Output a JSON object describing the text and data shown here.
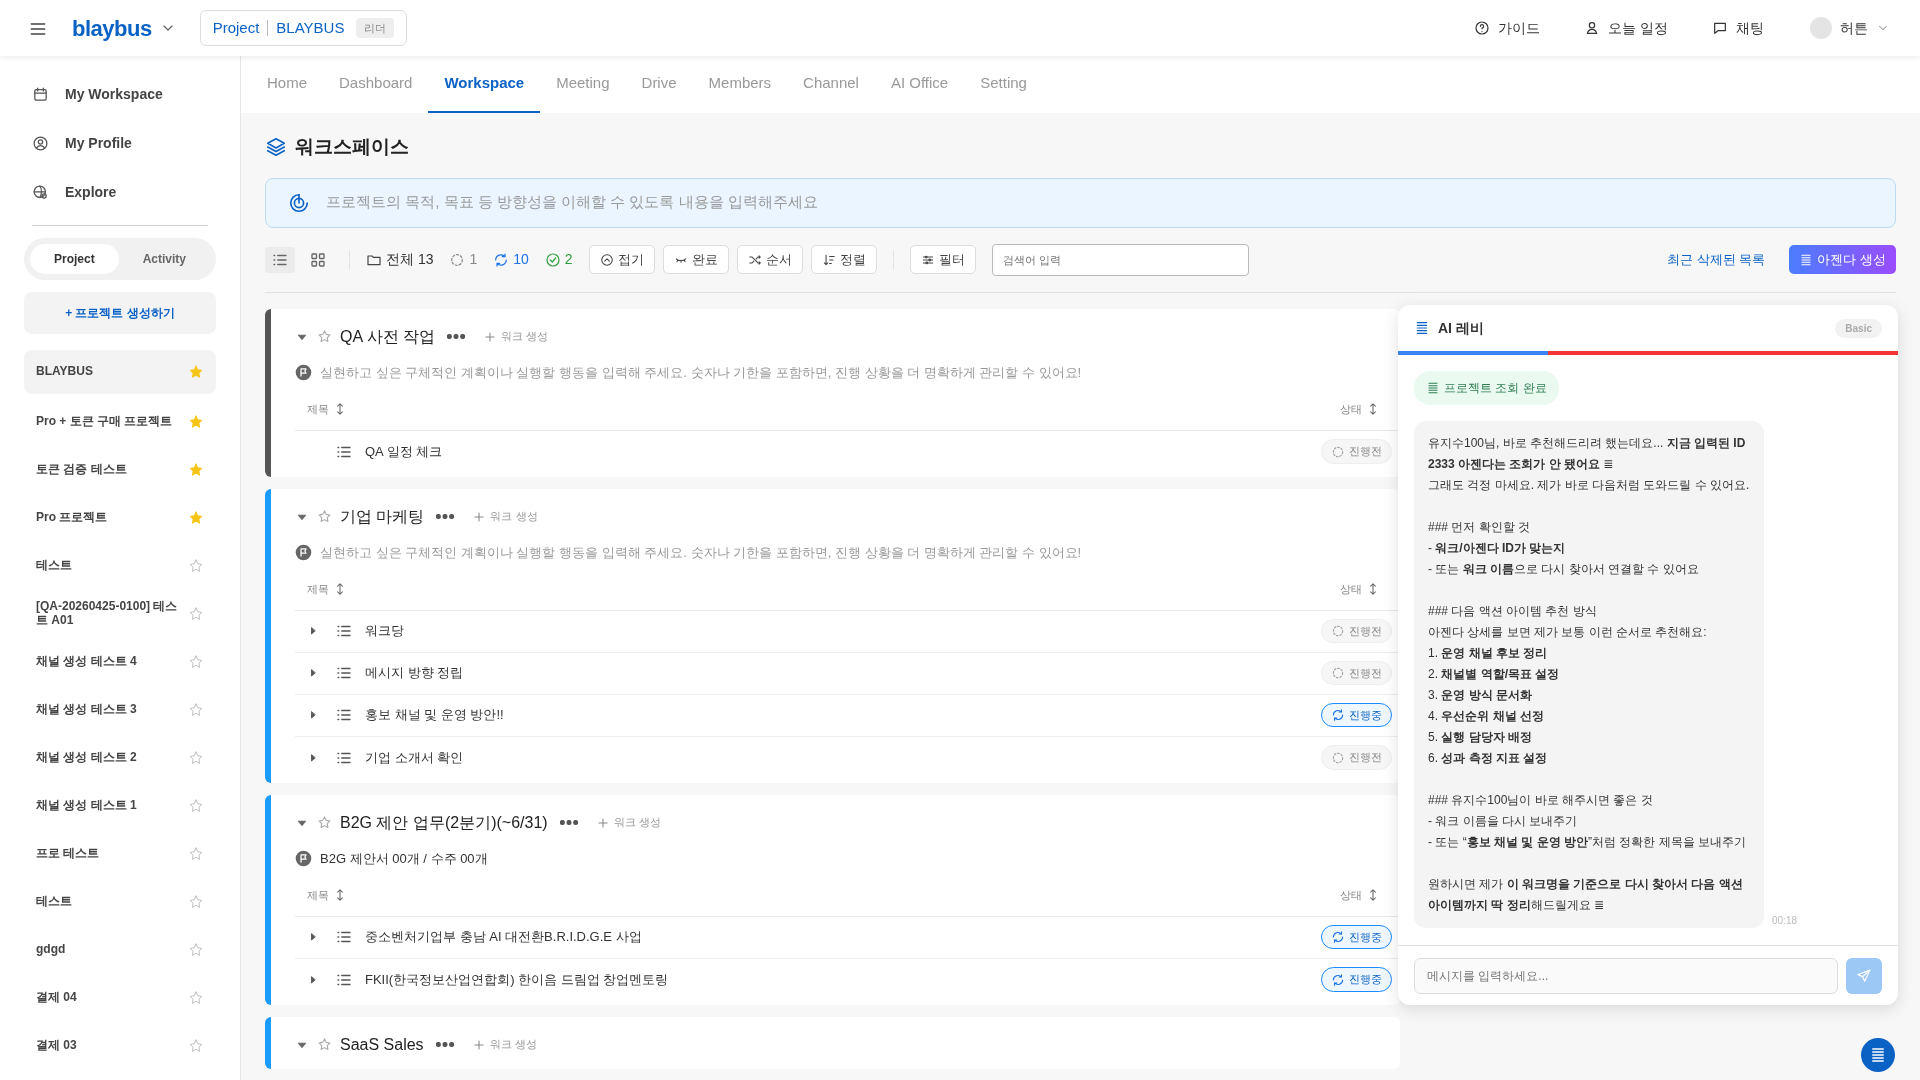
{
  "header": {
    "logo": "blaybus",
    "project_label": "Project",
    "project_name": "BLAYBUS",
    "role": "리더",
    "actions": [
      {
        "kind": "help",
        "label": "가이드"
      },
      {
        "kind": "person",
        "label": "오늘 일정"
      },
      {
        "kind": "chat",
        "label": "채팅"
      }
    ],
    "user": "허튼"
  },
  "sidebar": {
    "nav": [
      {
        "kind": "calendar",
        "label": "My Workspace"
      },
      {
        "kind": "profile",
        "label": "My Profile"
      },
      {
        "kind": "explore",
        "label": "Explore"
      }
    ],
    "segments": [
      {
        "label": "Project",
        "selected": true
      },
      {
        "label": "Activity",
        "selected": false
      }
    ],
    "create_button": "+ 프로젝트 생성하기",
    "projects": [
      {
        "name": "BLAYBUS",
        "selected": true,
        "starred": true
      },
      {
        "name": "Pro + 토큰 구매 프로젝트",
        "selected": false,
        "starred": true
      },
      {
        "name": "토큰 검증 테스트",
        "selected": false,
        "starred": true
      },
      {
        "name": "Pro 프로젝트",
        "selected": false,
        "starred": true
      },
      {
        "name": "테스트",
        "selected": false,
        "starred": false
      },
      {
        "name": "[QA-20260425-0100] 테스트 A01",
        "selected": false,
        "starred": false
      },
      {
        "name": "채널 생성 테스트 4",
        "selected": false,
        "starred": false
      },
      {
        "name": "채널 생성 테스트 3",
        "selected": false,
        "starred": false
      },
      {
        "name": "채널 생성 테스트 2",
        "selected": false,
        "starred": false
      },
      {
        "name": "채널 생성 테스트 1",
        "selected": false,
        "starred": false
      },
      {
        "name": "프로 테스트",
        "selected": false,
        "starred": false
      },
      {
        "name": "테스트",
        "selected": false,
        "starred": false
      },
      {
        "name": "gdgd",
        "selected": false,
        "starred": false
      },
      {
        "name": "결제 04",
        "selected": false,
        "starred": false
      },
      {
        "name": "결제 03",
        "selected": false,
        "starred": false
      }
    ]
  },
  "tabs": [
    {
      "label": "Home",
      "selected": false
    },
    {
      "label": "Dashboard",
      "selected": false
    },
    {
      "label": "Workspace",
      "selected": true
    },
    {
      "label": "Meeting",
      "selected": false
    },
    {
      "label": "Drive",
      "selected": false
    },
    {
      "label": "Members",
      "selected": false
    },
    {
      "label": "Channel",
      "selected": false
    },
    {
      "label": "AI Office",
      "selected": false
    },
    {
      "label": "Setting",
      "selected": false
    }
  ],
  "page_title": "워크스페이스",
  "goal_placeholder": "프로젝트의 목적, 목표 등 방향성을 이해할 수 있도록 내용을 입력해주세요",
  "toolbar": {
    "views": [
      {
        "kind": "list",
        "selected": true
      },
      {
        "kind": "grid",
        "selected": false
      }
    ],
    "counts": [
      {
        "kind": "all",
        "label": "전체 13"
      },
      {
        "kind": "todo",
        "label": "1"
      },
      {
        "kind": "doing",
        "label": "10"
      },
      {
        "kind": "done",
        "label": "2"
      }
    ],
    "buttons": [
      {
        "kind": "collapse",
        "label": "접기"
      },
      {
        "kind": "complete",
        "label": "완료"
      },
      {
        "kind": "order",
        "label": "순서"
      },
      {
        "kind": "sort",
        "label": "정렬"
      },
      {
        "kind": "filter",
        "label": "필터"
      }
    ],
    "search_placeholder": "검색어 입력",
    "deleted_link": "최근 삭제된 목록",
    "create_agenda": "아젠다 생성"
  },
  "groups": [
    {
      "title": "QA 사전 작업",
      "color": "#555555",
      "starred": false,
      "add_label": "워크 생성",
      "goal": "실현하고 싶은 구체적인 계획이나 실행할 행동을 입력해 주세요. 숫자나 기한을 포함하면, 진행 상황을 더 명확하게 관리할 수 있어요!",
      "goal_is_placeholder": true,
      "columns": [
        "제목",
        "상태"
      ],
      "rows": [
        {
          "title": "QA 일정 체크",
          "expandable": false,
          "status": "진행전",
          "kind": "todo"
        }
      ]
    },
    {
      "title": "기업 마케팅",
      "color": "#1a9bff",
      "starred": false,
      "add_label": "워크 생성",
      "goal": "실현하고 싶은 구체적인 계획이나 실행할 행동을 입력해 주세요. 숫자나 기한을 포함하면, 진행 상황을 더 명확하게 관리할 수 있어요!",
      "goal_is_placeholder": true,
      "columns": [
        "제목",
        "상태"
      ],
      "rows": [
        {
          "title": "워크당",
          "expandable": true,
          "status": "진행전",
          "kind": "todo"
        },
        {
          "title": "메시지 방향 정립",
          "expandable": true,
          "status": "진행전",
          "kind": "todo"
        },
        {
          "title": "홍보 채널 및 운영 방안!!",
          "expandable": true,
          "status": "진행중",
          "kind": "doing"
        },
        {
          "title": "기업 소개서 확인",
          "expandable": true,
          "status": "진행전",
          "kind": "todo"
        }
      ]
    },
    {
      "title": "B2G 제안 업무(2분기)(~6/31)",
      "color": "#1a9bff",
      "starred": false,
      "add_label": "워크 생성",
      "goal": "B2G 제안서 00개 / 수주 00개",
      "goal_is_placeholder": false,
      "columns": [
        "제목",
        "상태"
      ],
      "rows": [
        {
          "title": "중소벤처기업부 충남 AI 대전환B.R.I.D.G.E 사업",
          "expandable": true,
          "status": "진행중",
          "kind": "doing"
        },
        {
          "title": "FKII(한국정보산업연합회) 한이음 드림업 창업멘토링",
          "expandable": true,
          "status": "진행중",
          "kind": "doing"
        }
      ]
    },
    {
      "title": "SaaS Sales",
      "color": "#1a9bff",
      "starred": false,
      "add_label": "워크 생성"
    }
  ],
  "ai_panel": {
    "title": "AI 레비",
    "plan": "Basic",
    "header_bar": {
      "level": 0.3
    },
    "tool_chip": "프로젝트 조회 완료",
    "message": [
      [
        "유지수100님, 바로 추천해드리려 했는데요... **지금 입력된 ID 2333 아젠다는 조회가 안 됐어요** ≣",
        "그래도 걱정 마세요. 제가 바로 다음처럼 도와드릴 수 있어요."
      ],
      [
        "### 먼저 확인할 것",
        "- **워크/아젠다 ID가 맞는지**",
        "- 또는 **워크 이름**으로 다시 찾아서 연결할 수 있어요"
      ],
      [
        "### 다음 액션 아이템 추천 방식",
        "아젠다 상세를 보면 제가 보통 이런 순서로 추천해요:",
        "1. **운영 채널 후보 정리**",
        "2. **채널별 역할/목표 설정**",
        "3. **운영 방식 문서화**",
        "4. **우선순위 채널 선정**",
        "5. **실행 담당자 배정**",
        "6. **성과 측정 지표 설정**"
      ],
      [
        "### 유지수100님이 바로 해주시면 좋은 것",
        "- 워크 이름을 다시 보내주기",
        "- 또는 “**홍보 채널 및 운영 방안**”처럼 정확한 제목을 보내주기"
      ],
      [
        "원하시면 제가 **이 워크명을 기준으로 다시 찾아서 다음 액션 아이템까지 딱 정리**해드릴게요 ≣"
      ]
    ],
    "time": "00:18",
    "input_placeholder": "메시지를 입력하세요..."
  }
}
